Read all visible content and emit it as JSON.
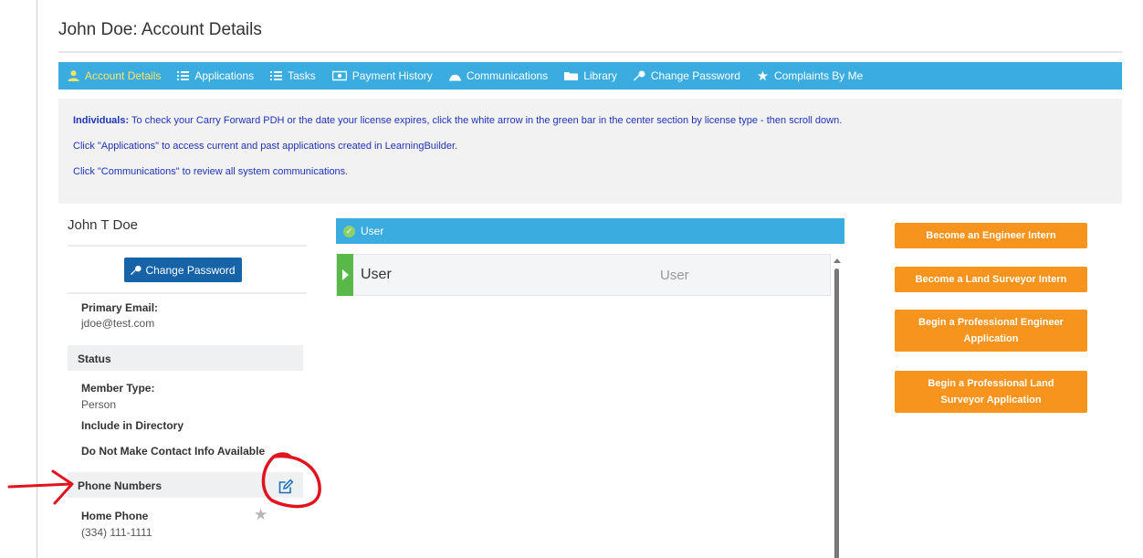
{
  "page": {
    "title": "John Doe: Account Details"
  },
  "nav": {
    "items": [
      {
        "label": "Account Details",
        "icon": "user-icon",
        "active": true
      },
      {
        "label": "Applications",
        "icon": "list-icon"
      },
      {
        "label": "Tasks",
        "icon": "list-icon"
      },
      {
        "label": "Payment History",
        "icon": "money-icon"
      },
      {
        "label": "Communications",
        "icon": "bell-icon"
      },
      {
        "label": "Library",
        "icon": "folder-icon"
      },
      {
        "label": "Change Password",
        "icon": "key-icon"
      },
      {
        "label": "Complaints By Me",
        "icon": "star-icon"
      }
    ]
  },
  "info": {
    "line1_bold": "Individuals:",
    "line1_text": " To check your Carry Forward PDH or the date your license expires, click the white arrow in the green bar in the center section by license type - then scroll down.",
    "line2": "Click \"Applications\" to access current and past applications created in LearningBuilder.",
    "line3": "Click \"Communications\" to review all system communications."
  },
  "profile": {
    "name": "John T Doe",
    "change_password_label": "Change Password",
    "primary_email_label": "Primary Email:",
    "primary_email": "jdoe@test.com",
    "status_header": "Status",
    "member_type_label": "Member Type:",
    "member_type": "Person",
    "include_directory_label": "Include in Directory",
    "no_contact_label": "Do Not Make Contact Info Available",
    "phone_header": "Phone Numbers",
    "home_phone_label": "Home Phone",
    "home_phone": "(334) 111-1111"
  },
  "roles": {
    "bar_label": "User",
    "row_title": "User",
    "row_type": "User"
  },
  "actions": {
    "engineer_intern": "Become an Engineer Intern",
    "surveyor_intern": "Become a Land Surveyor Intern",
    "pe_application": "Begin a Professional Engineer Application",
    "pls_application": "Begin a Professional Land Surveyor Application"
  },
  "colors": {
    "nav_bg": "#3aace0",
    "nav_active": "#ffe36b",
    "info_text": "#1f33b8",
    "primary_button": "#1663a8",
    "action_button": "#f7941d",
    "annotation": "#e0141e"
  }
}
